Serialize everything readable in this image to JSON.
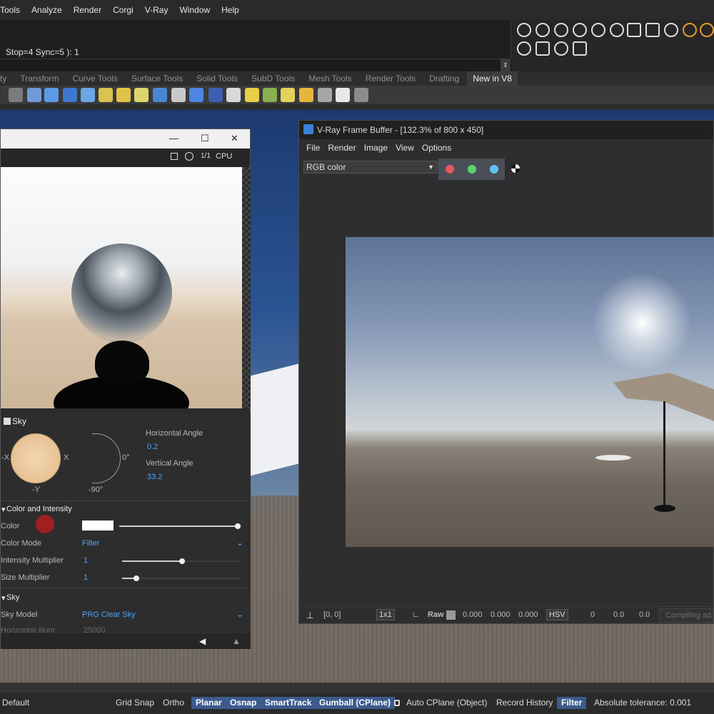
{
  "menu": {
    "items": [
      "Tools",
      "Analyze",
      "Render",
      "Corgi",
      "V-Ray",
      "Window",
      "Help"
    ]
  },
  "command": {
    "history": "Stop=4  Sync=5 ): 1"
  },
  "tabs": {
    "items": [
      "ty",
      "Transform",
      "Curve Tools",
      "Surface Tools",
      "Solid Tools",
      "SubD Tools",
      "Mesh Tools",
      "Render Tools",
      "Drafting"
    ],
    "active": "New in V8"
  },
  "material_window": {
    "minimize": "—",
    "maximize": "☐",
    "close": "✕",
    "toolbar_ratio": "1/1",
    "toolbar_device": "CPU",
    "sky_header": "Sky",
    "compass_labels": {
      "left": "-X",
      "right": "X",
      "bottom": "-Y"
    },
    "elev_labels": {
      "zero": "0°",
      "bottom": "-90°"
    },
    "horizontal_angle_label": "Horizontal Angle",
    "horizontal_angle_value": "0.2",
    "vertical_angle_label": "Vertical Angle",
    "vertical_angle_value": "33.2",
    "color_intensity_header": "Color and Intensity",
    "color_label": "Color",
    "color_mode_label": "Color Mode",
    "color_mode_value": "Filter",
    "intensity_label": "Intensity Multiplier",
    "intensity_value": "1",
    "size_label": "Size Multiplier",
    "size_value": "1",
    "sky_section_header": "Sky",
    "sky_model_label": "Sky Model",
    "sky_model_value": "PRG Clear Sky",
    "horiz_illum_label": "Horizontal Illum",
    "horiz_illum_value": "25000"
  },
  "vfb": {
    "title": "V-Ray Frame Buffer - [132.3% of 800 x 450]",
    "menu": [
      "File",
      "Render",
      "Image",
      "View",
      "Options"
    ],
    "channel": "RGB color",
    "channel_colors": [
      "#e8585f",
      "#5ed36a",
      "#63c3f0"
    ],
    "status": {
      "coords": "[0, 0]",
      "zoom": "1x1",
      "raw_label": "Raw",
      "r": "0.000",
      "g": "0.000",
      "b": "0.000",
      "mode": "HSV",
      "h": "0",
      "s": "0.0",
      "v": "0.0",
      "progress": "Compiling ad"
    }
  },
  "statusbar": {
    "layer": "Default",
    "grid_snap": "Grid Snap",
    "ortho": "Ortho",
    "planar": "Planar",
    "osnap": "Osnap",
    "smarttrack": "SmartTrack",
    "gumball": "Gumball (CPlane)",
    "auto_cplane": "Auto CPlane (Object)",
    "record_history": "Record History",
    "filter": "Filter",
    "tolerance": "Absolute tolerance: 0.001"
  }
}
